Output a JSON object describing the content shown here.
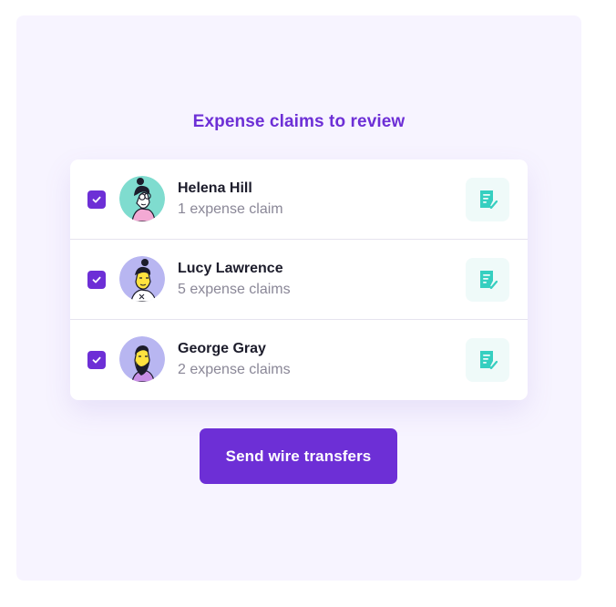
{
  "title": "Expense claims to review",
  "rows": [
    {
      "name": "Helena Hill",
      "claims": "1 expense claim",
      "checked": true,
      "avatar_color": "#7fdccf"
    },
    {
      "name": "Lucy Lawrence",
      "claims": "5 expense claims",
      "checked": true,
      "avatar_color": "#b8b6f1"
    },
    {
      "name": "George Gray",
      "claims": "2 expense claims",
      "checked": true,
      "avatar_color": "#b8b6f1"
    }
  ],
  "button": {
    "label": "Send wire transfers"
  },
  "colors": {
    "accent": "#6d2fd6",
    "panel_bg": "#f7f4ff",
    "doc_icon": "#36cfc0",
    "doc_icon_bg": "#effaf9"
  },
  "icons": {
    "checkbox": "checkmark-icon",
    "row_action": "receipt-check-icon"
  }
}
